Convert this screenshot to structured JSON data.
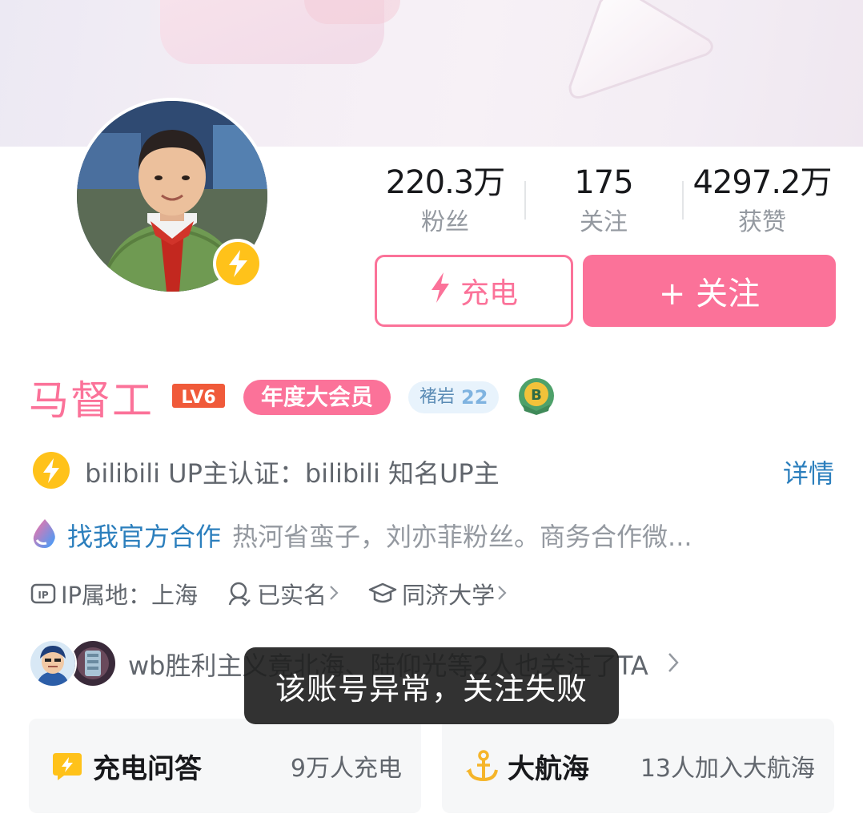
{
  "stats": [
    {
      "value": "220.3万",
      "label": "粉丝"
    },
    {
      "value": "175",
      "label": "关注"
    },
    {
      "value": "4297.2万",
      "label": "获赞"
    }
  ],
  "actions": {
    "charge_label": "充电",
    "follow_label": "+ 关注"
  },
  "profile": {
    "username": "马督工",
    "level": "LV6",
    "vip_label": "年度大会员",
    "medal_name": "褚岩",
    "medal_level": "22"
  },
  "verification": {
    "text": "bilibili UP主认证：bilibili 知名UP主",
    "detail_label": "详情"
  },
  "bio_row": {
    "coop_label": "找我官方合作",
    "bio": "热河省蛮子，刘亦菲粉丝。商务合作微..."
  },
  "meta": {
    "ip_location": "IP属地：上海",
    "real_name": "已实名",
    "school": "同济大学"
  },
  "mutual": {
    "text": "wb胜利主义竟北海、陆仰光等2人也关注了TA"
  },
  "toast": {
    "message": "该账号异常，关注失败"
  },
  "cards": {
    "charge_qa_title": "充电问答",
    "charge_qa_sub": "9万人充电",
    "voyage_title": "大航海",
    "voyage_sub": "13人加入大航海"
  },
  "colors": {
    "brand_pink": "#fb7299",
    "link_blue": "#2c7fbd",
    "badge_yellow": "#ffc21a"
  },
  "icons": [
    "bolt-icon",
    "plus-icon",
    "lv6-badge-icon",
    "rank-medal-icon",
    "verify-bolt-icon",
    "coop-drop-icon",
    "ip-icon",
    "real-name-icon",
    "school-cap-icon",
    "chevron-right-icon",
    "charge-qa-icon",
    "anchor-icon"
  ]
}
